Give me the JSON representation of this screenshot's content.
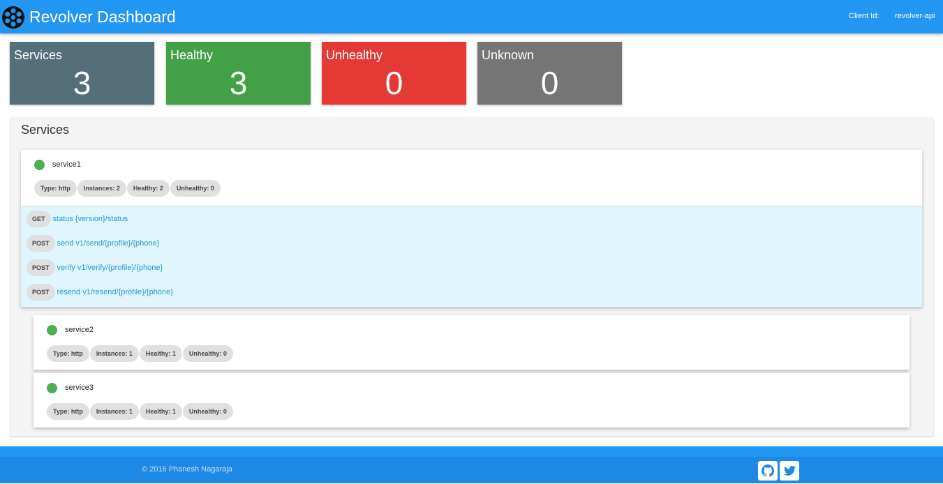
{
  "header": {
    "title": "Revolver Dashboard",
    "client_label": "Client Id:",
    "client_value": "revolver-api"
  },
  "summary_cards": [
    {
      "label": "Services",
      "value": "3",
      "color": "#546e7a"
    },
    {
      "label": "Healthy",
      "value": "3",
      "color": "#43a047"
    },
    {
      "label": "Unhealthy",
      "value": "0",
      "color": "#e53935"
    },
    {
      "label": "Unknown",
      "value": "0",
      "color": "#757575"
    }
  ],
  "services_panel": {
    "title": "Services",
    "services": [
      {
        "name": "service1",
        "status_color": "#4caf50",
        "chips": [
          "Type: http",
          "Instances: 2",
          "Healthy: 2",
          "Unhealthy: 0"
        ],
        "endpoints": [
          {
            "method": "GET",
            "text": "status {version}/status"
          },
          {
            "method": "POST",
            "text": "send v1/send/{profile}/{phone}"
          },
          {
            "method": "POST",
            "text": "verify v1/verify/{profile}/{phone}"
          },
          {
            "method": "POST",
            "text": "resend v1/resend/{profile}/{phone}"
          }
        ]
      },
      {
        "name": "service2",
        "status_color": "#4caf50",
        "chips": [
          "Type: http",
          "Instances: 1",
          "Healthy: 1",
          "Unhealthy: 0"
        ]
      },
      {
        "name": "service3",
        "status_color": "#4caf50",
        "chips": [
          "Type: http",
          "Instances: 1",
          "Healthy: 1",
          "Unhealthy: 0"
        ]
      }
    ]
  },
  "footer": {
    "copyright": "© 2016 Phanesh Nagaraja",
    "icons": [
      "github-icon",
      "twitter-icon"
    ]
  }
}
